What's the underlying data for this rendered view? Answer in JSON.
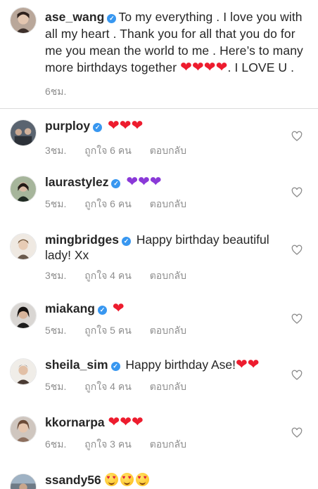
{
  "caption": {
    "username": "ase_wang",
    "text": "To my everything . I love you with all my heart . Thank you for all that you do for me you mean the world to me . Here’s to many more birthdays together",
    "hearts": "❤❤❤❤",
    "tail": ". I LOVE U .",
    "time": "6ชม."
  },
  "labels": {
    "reply": "ตอบกลับ"
  },
  "comments": [
    {
      "username": "purploy",
      "verified": true,
      "text": "",
      "emoji": "❤❤❤",
      "emoji_kind": "red",
      "time": "3ชม.",
      "likes": "ถูกใจ 6 คน"
    },
    {
      "username": "laurastylez",
      "verified": true,
      "text": "",
      "emoji": "❤❤❤",
      "emoji_kind": "purple",
      "time": "5ชม.",
      "likes": "ถูกใจ 6 คน"
    },
    {
      "username": "mingbridges",
      "verified": true,
      "text": "Happy birthday beautiful lady! Xx",
      "emoji": "",
      "time": "3ชม.",
      "likes": "ถูกใจ 4 คน"
    },
    {
      "username": "miakang",
      "verified": true,
      "text": "",
      "emoji": "❤",
      "emoji_kind": "red",
      "time": "5ชม.",
      "likes": "ถูกใจ 5 คน"
    },
    {
      "username": "sheila_sim",
      "verified": true,
      "text": "Happy birthday Ase!",
      "emoji": "❤❤",
      "emoji_kind": "red",
      "time": "5ชม.",
      "likes": "ถูกใจ 4 คน"
    },
    {
      "username": "kkornarpa",
      "verified": false,
      "text": "",
      "emoji": "❤❤❤",
      "emoji_kind": "red",
      "time": "6ชม.",
      "likes": "ถูกใจ 3 คน"
    },
    {
      "username": "ssandy56",
      "verified": false,
      "text": "",
      "emoji": "😍😍😍",
      "emoji_kind": "heart-eyes"
    }
  ]
}
